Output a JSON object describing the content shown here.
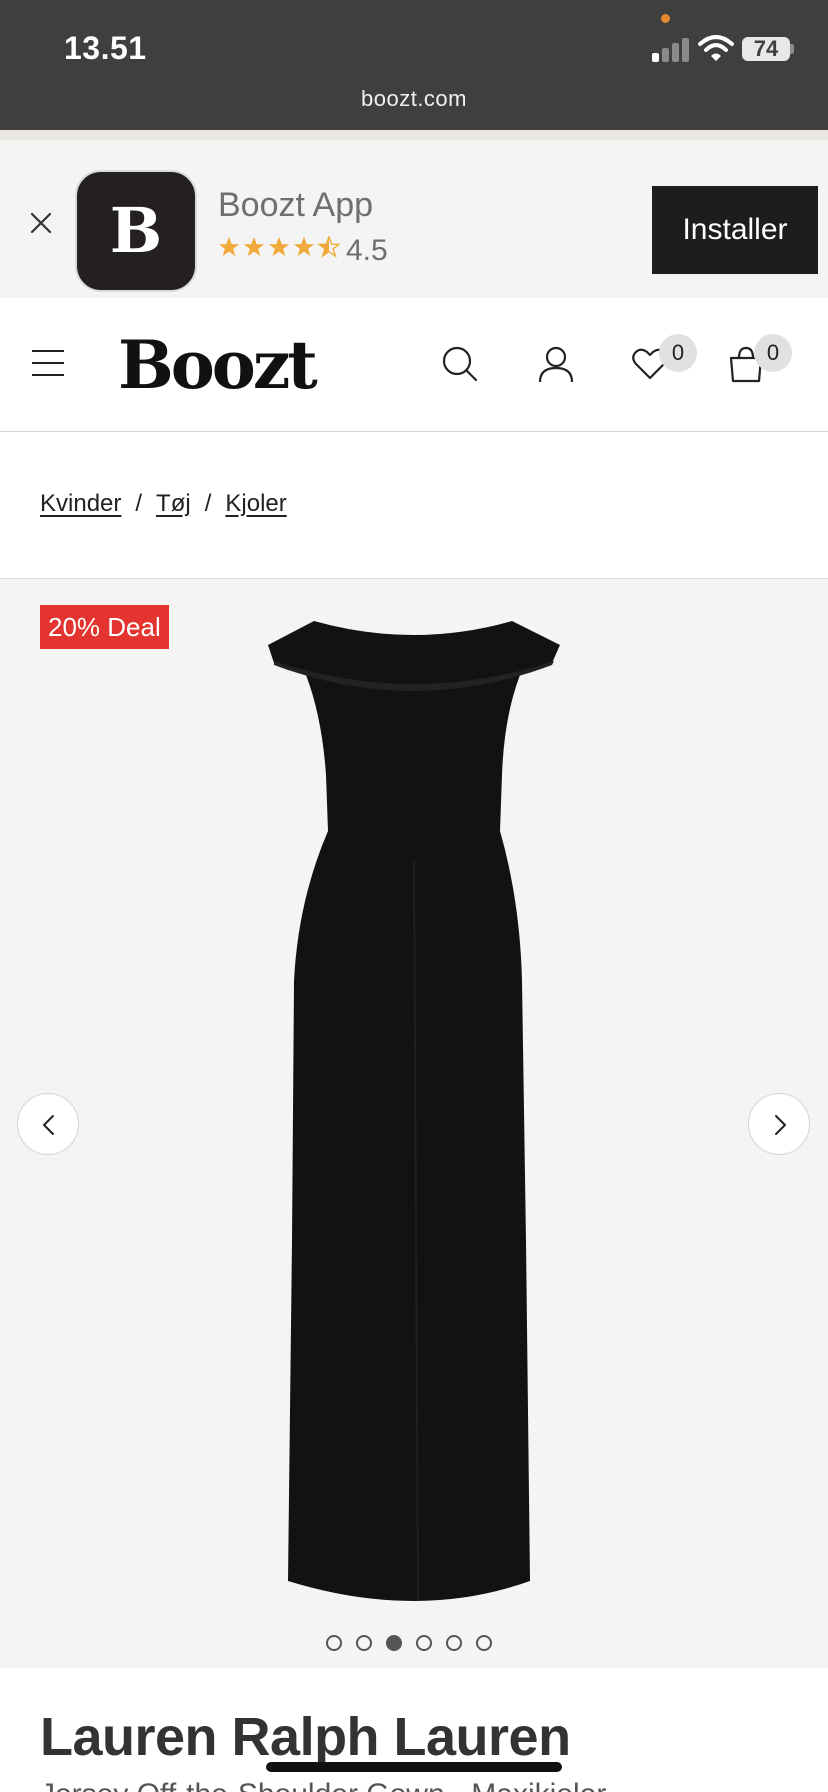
{
  "status_bar": {
    "time": "13.51",
    "battery": "74"
  },
  "browser": {
    "url": "boozt.com"
  },
  "app_banner": {
    "app_icon_letter": "B",
    "app_name": "Boozt App",
    "rating": "4.5",
    "install_label": "Installer"
  },
  "header": {
    "logo": "Boozt",
    "wishlist_count": "0",
    "cart_count": "0"
  },
  "breadcrumb": {
    "items": [
      {
        "label": "Kvinder"
      },
      {
        "label": "Tøj"
      },
      {
        "label": "Kjoler"
      }
    ],
    "separator": "/"
  },
  "gallery": {
    "deal_badge": "20% Deal",
    "image_count": 6,
    "active_index": 2
  },
  "product": {
    "brand": "Lauren Ralph Lauren",
    "subtitle": "Jersey Off-the-Shoulder Gown - Maxikjoler"
  },
  "colors": {
    "status_bar_bg": "#3f3f3f",
    "deal_red": "#e3342f",
    "star_gold": "#f0a93a",
    "install_bg": "#1d1d1d"
  }
}
